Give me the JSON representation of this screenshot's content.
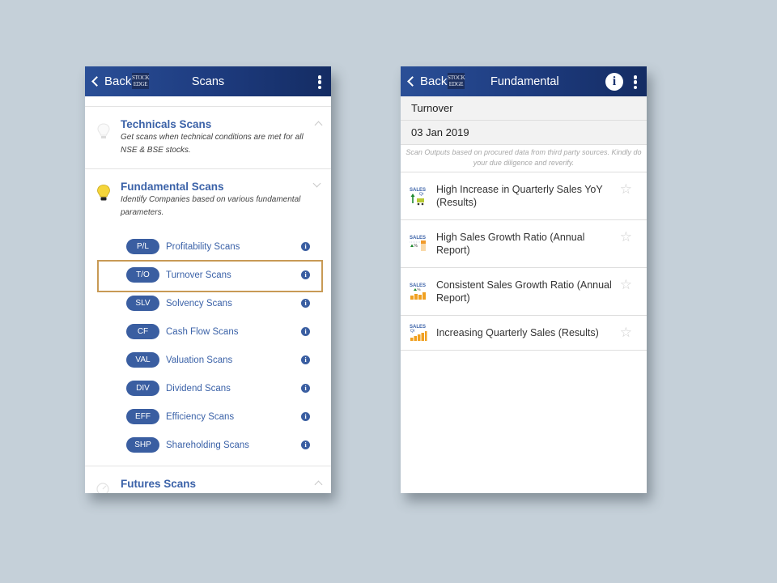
{
  "left_screen": {
    "header": {
      "back_label": "Back",
      "logo_line1": "STOCK",
      "logo_line2": "EDGE",
      "title": "Scans"
    },
    "sections": [
      {
        "title": "Technicals Scans",
        "description": "Get scans when technical conditions are met for all NSE & BSE stocks.",
        "expanded": false
      },
      {
        "title": "Fundamental Scans",
        "description": "Identify Companies based on various fundamental parameters.",
        "expanded": true
      },
      {
        "title": "Futures Scans",
        "expanded": false
      }
    ],
    "fundamental_items": [
      {
        "badge": "P/L",
        "label": "Profitability Scans"
      },
      {
        "badge": "T/O",
        "label": "Turnover Scans",
        "highlighted": true
      },
      {
        "badge": "SLV",
        "label": "Solvency Scans"
      },
      {
        "badge": "CF",
        "label": "Cash Flow Scans"
      },
      {
        "badge": "VAL",
        "label": "Valuation Scans"
      },
      {
        "badge": "DIV",
        "label": "Dividend Scans"
      },
      {
        "badge": "EFF",
        "label": "Efficiency Scans"
      },
      {
        "badge": "SHP",
        "label": "Shareholding Scans"
      }
    ],
    "info_glyph": "i"
  },
  "right_screen": {
    "header": {
      "back_label": "Back",
      "logo_line1": "STOCK",
      "logo_line2": "EDGE",
      "title": "Fundamental",
      "info_glyph": "i"
    },
    "category": "Turnover",
    "date": "03 Jan 2019",
    "disclaimer": "Scan Outputs based on procured data from third party sources. Kindly do your due diligence and reverify.",
    "results": [
      {
        "label": "High Increase in Quarterly Sales YoY (Results)",
        "icon": "sales-qtr-yoy-icon",
        "icon_text": "SALES",
        "icon_sub": "Qr"
      },
      {
        "label": "High Sales Growth Ratio (Annual Report)",
        "icon": "sales-growth-ratio-icon",
        "icon_text": "SALES",
        "icon_sub": "▲%"
      },
      {
        "label": "Consistent Sales Growth Ratio (Annual Report)",
        "icon": "sales-consistent-growth-icon",
        "icon_text": "SALES",
        "icon_sub": "▲%"
      },
      {
        "label": "Increasing Quarterly Sales (Results)",
        "icon": "sales-increasing-qtr-icon",
        "icon_text": "SALES",
        "icon_sub": "Qr"
      }
    ],
    "star_glyph": "☆"
  },
  "colors": {
    "header_start": "#2a4f97",
    "header_end": "#142c63",
    "accent_blue": "#3b62a8",
    "badge_blue": "#3a5ea1",
    "highlight_border": "#c89a55",
    "background": "#c5d0d9"
  }
}
